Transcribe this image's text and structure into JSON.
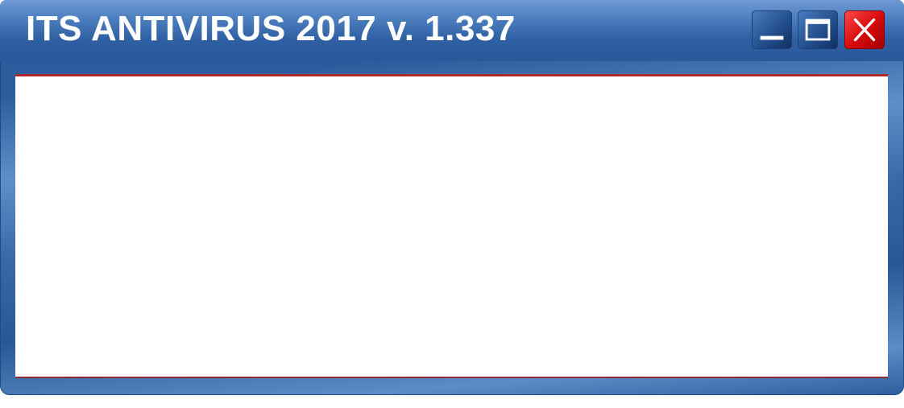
{
  "window": {
    "title": "ITS ANTIVIRUS 2017 v. 1.337",
    "controls": {
      "minimize_icon": "minimize-icon",
      "maximize_icon": "maximize-icon",
      "close_icon": "close-icon"
    }
  },
  "colors": {
    "frame": "#2b5d9e",
    "titlebar": "#4d7fbf",
    "close_button": "#d80c0c",
    "content_accent": "#b02a2a",
    "content_background": "#ffffff"
  }
}
